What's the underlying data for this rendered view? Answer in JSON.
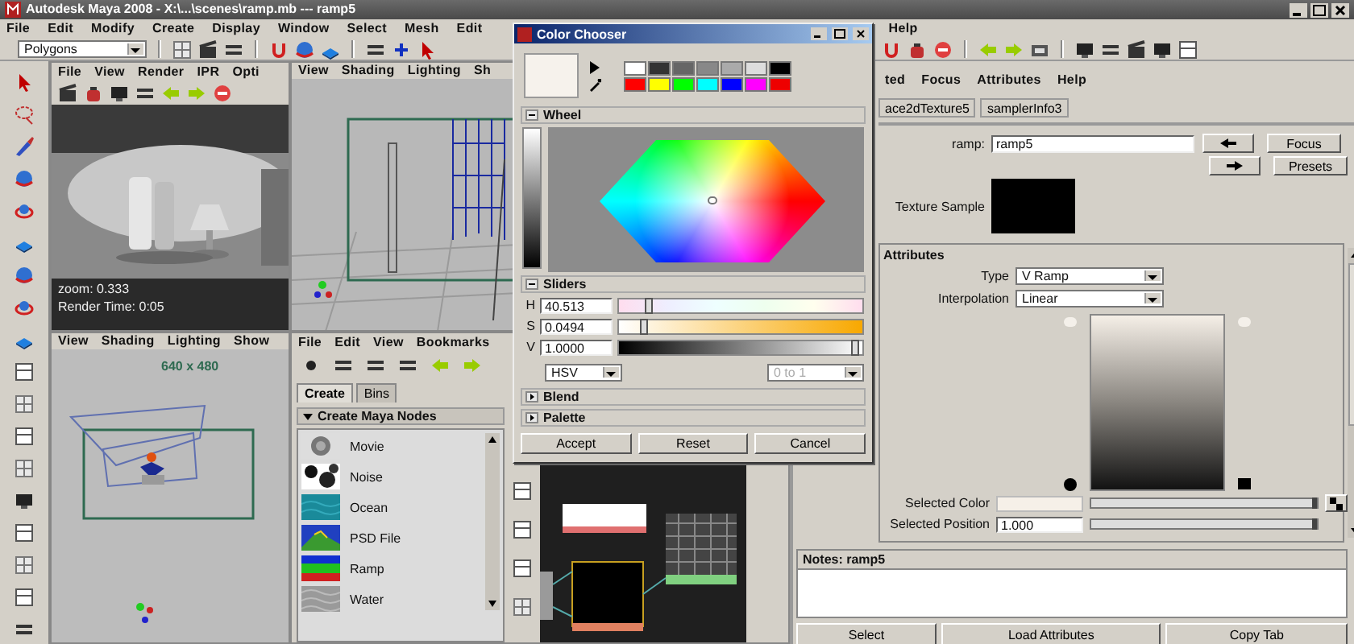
{
  "window": {
    "title": "Autodesk Maya 2008  -  X:\\...\\scenes\\ramp.mb  ---  ramp5"
  },
  "menu_bar": {
    "items": [
      "File",
      "Edit",
      "Modify",
      "Create",
      "Display",
      "Window",
      "Select",
      "Mesh",
      "Edit"
    ],
    "trailing": [
      "Help"
    ]
  },
  "toolbar": {
    "menu_set": "Polygons"
  },
  "render_view": {
    "menu": [
      "File",
      "View",
      "Render",
      "IPR",
      "Opti"
    ],
    "caption": [
      "zoom: 0.333",
      "Render Time: 0:05"
    ]
  },
  "perspective_view": {
    "menu": [
      "View",
      "Shading",
      "Lighting",
      "Sh"
    ]
  },
  "camera_view": {
    "menu": [
      "View",
      "Shading",
      "Lighting",
      "Show"
    ],
    "resolution": "640 x 480"
  },
  "hypershade": {
    "menu": [
      "File",
      "Edit",
      "View",
      "Bookmarks"
    ],
    "tabs": [
      {
        "label": "Create",
        "selected": true
      },
      {
        "label": "Bins",
        "selected": false
      }
    ],
    "section": "Create Maya Nodes",
    "nodes": [
      {
        "label": "Movie",
        "kind": "movie"
      },
      {
        "label": "Noise",
        "kind": "noise"
      },
      {
        "label": "Ocean",
        "kind": "ocean"
      },
      {
        "label": "PSD File",
        "kind": "psd"
      },
      {
        "label": "Ramp",
        "kind": "ramp"
      },
      {
        "label": "Water",
        "kind": "water"
      }
    ]
  },
  "color_chooser": {
    "title": "Color Chooser",
    "palette": [
      {
        "color": "#ffffff"
      },
      {
        "color": "#333333"
      },
      {
        "color": "#666666"
      },
      {
        "color": "#888888"
      },
      {
        "color": "#aaaaaa"
      },
      {
        "color": "#dddddd"
      },
      {
        "color": "#000000"
      },
      {
        "color": "#ff0000"
      },
      {
        "color": "#ffff00"
      },
      {
        "color": "#00ff00"
      },
      {
        "color": "#00ffff"
      },
      {
        "color": "#0000ff"
      },
      {
        "color": "#ff00ff"
      },
      {
        "color": "#ee0000"
      }
    ],
    "sections": [
      {
        "label": "Wheel",
        "expanded": true
      },
      {
        "label": "Sliders",
        "expanded": true
      },
      {
        "label": "Blend",
        "expanded": false
      },
      {
        "label": "Palette",
        "expanded": false
      }
    ],
    "sliders": [
      {
        "name": "H",
        "value": "40.513",
        "level": 0.12,
        "kind": "hue"
      },
      {
        "name": "S",
        "value": "0.0494",
        "level": 0.1,
        "kind": "saturation"
      },
      {
        "name": "V",
        "value": "1.0000",
        "level": 1.0,
        "kind": "value"
      }
    ],
    "mode": {
      "value": "HSV",
      "disabled": false
    },
    "range": {
      "value": "0 to 1",
      "disabled": true
    },
    "buttons": [
      "Accept",
      "Reset",
      "Cancel"
    ]
  },
  "attribute_editor": {
    "menu": [
      "ted",
      "Focus",
      "Attributes",
      "Help"
    ],
    "tabs": [
      {
        "label": "ace2dTexture5",
        "selected": false
      },
      {
        "label": "samplerInfo3",
        "selected": false
      }
    ],
    "node_label": "ramp:",
    "node_name": "ramp5",
    "buttons": [
      "Focus",
      "Presets"
    ],
    "texture_sample_label": "Texture Sample",
    "section": "Attributes",
    "type": {
      "label": "Type",
      "value": "V Ramp"
    },
    "interpolation": {
      "label": "Interpolation",
      "value": "Linear"
    },
    "selected_color": {
      "label": "Selected Color",
      "level": 1.0
    },
    "selected_position": {
      "label": "Selected Position",
      "value": "1.000",
      "level": 1.0
    },
    "notes_label": "Notes:  ramp5",
    "bottom_buttons": [
      "Select",
      "Load Attributes",
      "Copy Tab"
    ]
  }
}
